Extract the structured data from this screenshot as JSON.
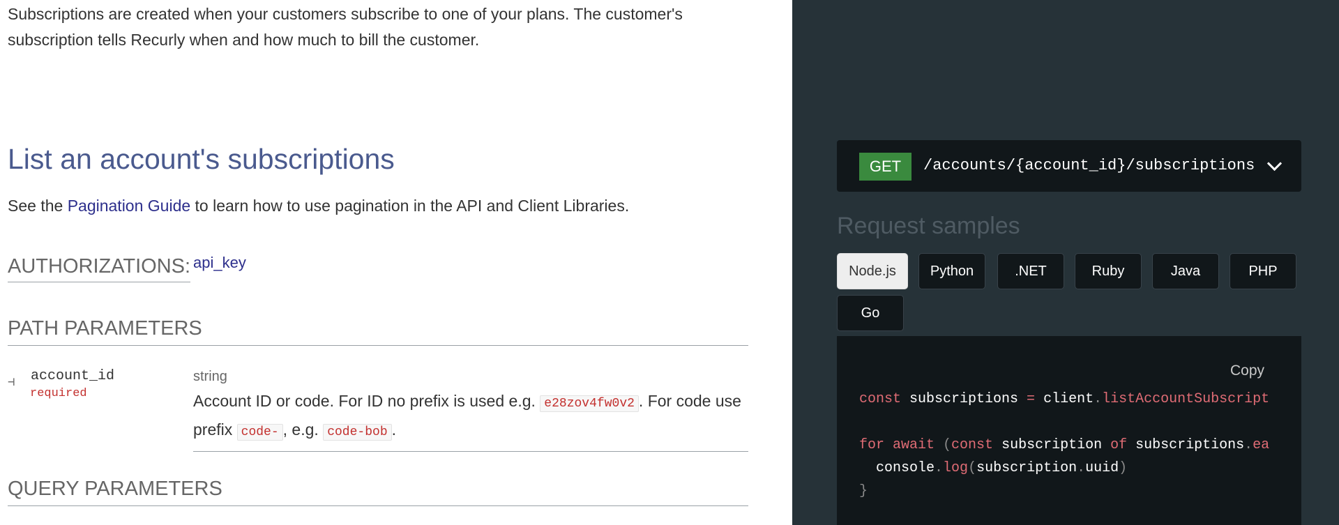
{
  "intro": {
    "text": "Subscriptions are created when your customers subscribe to one of your plans. The customer's subscription tells Recurly when and how much to bill the customer."
  },
  "operation": {
    "title": "List an account's subscriptions",
    "see_prefix": "See the ",
    "see_link": "Pagination Guide",
    "see_suffix": " to learn how to use pagination in the API and Client Libraries."
  },
  "authorizations": {
    "heading": "AUTHORIZATIONS:",
    "value": "api_key"
  },
  "path_parameters": {
    "heading": "PATH PARAMETERS",
    "param": {
      "line_glyph": "⊣",
      "name": "account_id",
      "required": "required",
      "type": "string",
      "desc_1": "Account ID or code. For ID no prefix is used e.g. ",
      "code_1": "e28zov4fw0v2",
      "desc_2": ". For code use prefix ",
      "code_2": "code-",
      "desc_3": ", e.g. ",
      "code_3": "code-bob",
      "desc_4": "."
    }
  },
  "query_parameters": {
    "heading": "QUERY PARAMETERS"
  },
  "endpoint": {
    "method": "GET",
    "path": "/accounts/{account_id}/subscriptions",
    "chevron_icon": "chevron-down-icon"
  },
  "request_samples": {
    "title": "Request samples",
    "tabs": [
      "Node.js",
      "Python",
      ".NET",
      "Ruby",
      "Java",
      "PHP",
      "Go"
    ],
    "active_tab": "Node.js",
    "copy_label": "Copy",
    "code": {
      "l1_kw": "const",
      "l1_var": " subscriptions ",
      "l1_op": "=",
      "l1_obj": " client",
      "l1_dot": ".",
      "l1_fn": "listAccountSubscript",
      "l3_kw1": "for",
      "l3_kw2": " await",
      "l3_paren": " (",
      "l3_kw3": "const",
      "l3_var": " subscription ",
      "l3_kw4": "of",
      "l3_obj": " subscriptions",
      "l3_dot": ".",
      "l3_fn": "ea",
      "l4_obj": "  console",
      "l4_dot": ".",
      "l4_fn": "log",
      "l4_open": "(",
      "l4_arg": "subscription",
      "l4_dot2": ".",
      "l4_prop": "uuid",
      "l4_close": ")",
      "l5": "}"
    }
  },
  "colors": {
    "panel_bg": "#263238",
    "code_bg": "#11171a",
    "get_badge": "#3a8a3e",
    "link": "#2d2f8c",
    "title": "#4a5a8e",
    "code_accent": "#e06c75"
  }
}
